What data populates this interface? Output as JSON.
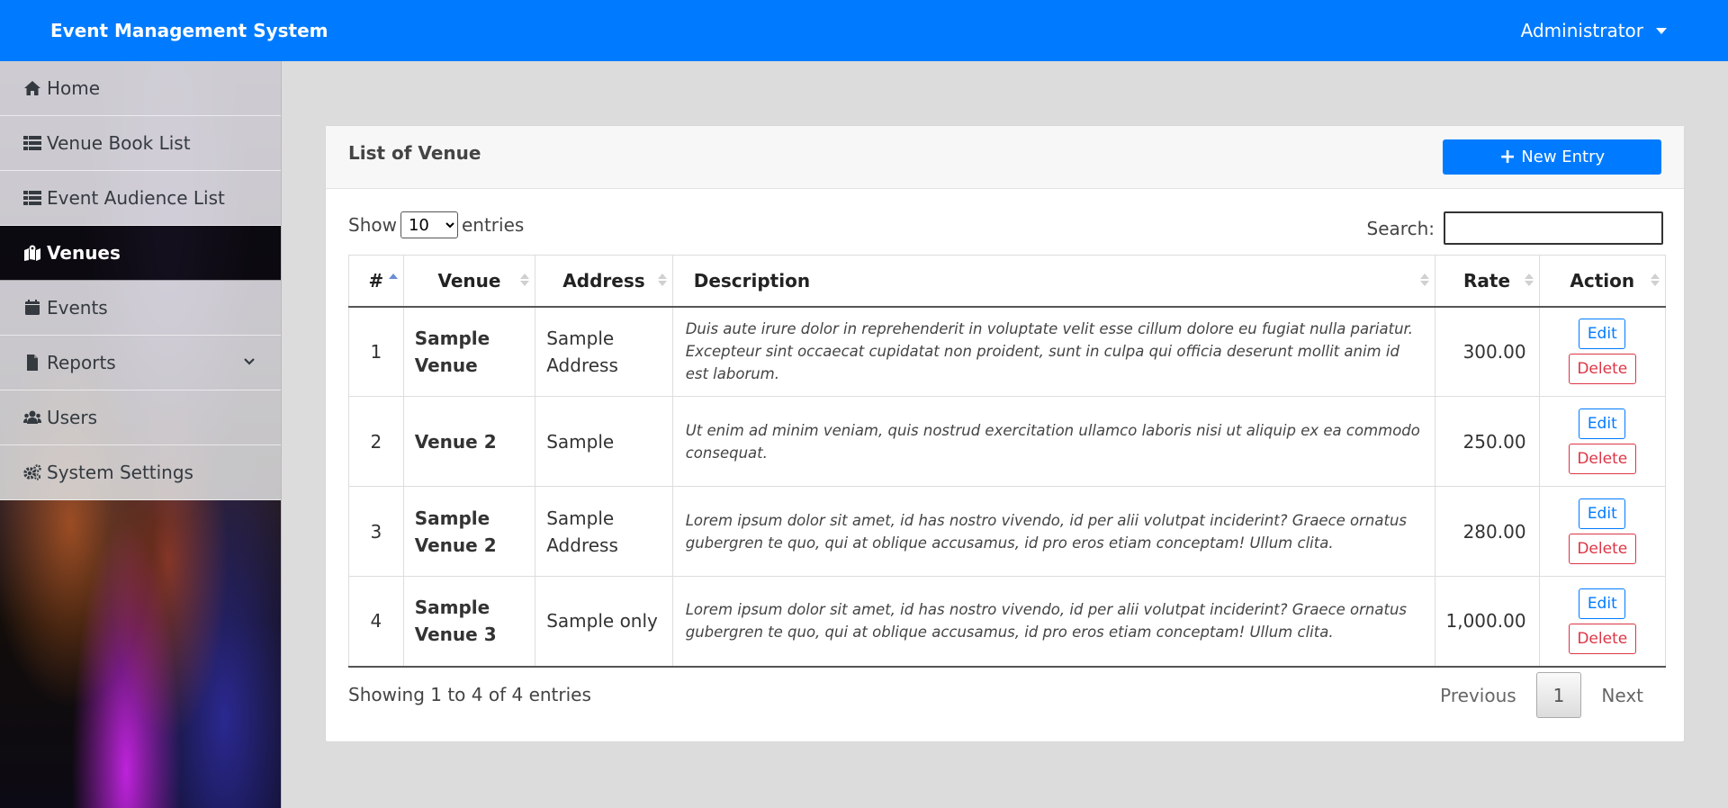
{
  "header": {
    "brand": "Event Management System",
    "user": "Administrator"
  },
  "sidebar": {
    "items": [
      {
        "label": "Home",
        "icon": "home-icon"
      },
      {
        "label": "Venue Book List",
        "icon": "list-icon"
      },
      {
        "label": "Event Audience List",
        "icon": "list-icon"
      },
      {
        "label": "Venues",
        "icon": "map-marked-icon",
        "active": true
      },
      {
        "label": "Events",
        "icon": "calendar-icon"
      },
      {
        "label": "Reports",
        "icon": "file-icon",
        "expandable": true
      },
      {
        "label": "Users",
        "icon": "users-icon"
      },
      {
        "label": "System Settings",
        "icon": "cogs-icon"
      }
    ]
  },
  "card": {
    "title": "List of Venue",
    "new_button": "New Entry",
    "show_label": "Show",
    "entries_label": "entries",
    "page_length": "10",
    "search_label": "Search:",
    "search_value": "",
    "columns": [
      "#",
      "Venue",
      "Address",
      "Description",
      "Rate",
      "Action"
    ],
    "rows": [
      {
        "num": "1",
        "venue": "Sample Venue",
        "address": "Sample Address",
        "description": "Duis aute irure dolor in reprehenderit in voluptate velit esse cillum dolore eu fugiat nulla pariatur. Excepteur sint occaecat cupidatat non proident, sunt in culpa qui officia deserunt mollit anim id est laborum.",
        "rate": "300.00"
      },
      {
        "num": "2",
        "venue": "Venue 2",
        "address": "Sample",
        "description": "Ut enim ad minim veniam, quis nostrud exercitation ullamco laboris nisi ut aliquip ex ea commodo consequat.",
        "rate": "250.00"
      },
      {
        "num": "3",
        "venue": "Sample Venue 2",
        "address": "Sample Address",
        "description": "Lorem ipsum dolor sit amet, id has nostro vivendo, id per alii volutpat inciderint? Graece ornatus gubergren te quo, qui at oblique accusamus, id pro eros etiam conceptam! Ullum clita.",
        "rate": "280.00"
      },
      {
        "num": "4",
        "venue": "Sample Venue 3",
        "address": "Sample only",
        "description": "Lorem ipsum dolor sit amet, id has nostro vivendo, id per alii volutpat inciderint? Graece ornatus gubergren te quo, qui at oblique accusamus, id pro eros etiam conceptam! Ullum clita.",
        "rate": "1,000.00"
      }
    ],
    "edit_label": "Edit",
    "delete_label": "Delete",
    "info": "Showing 1 to 4 of 4 entries",
    "pagination": {
      "previous": "Previous",
      "current": "1",
      "next": "Next"
    }
  },
  "colors": {
    "primary": "#007bff",
    "danger": "#dc3545",
    "active_nav": "#000000"
  }
}
